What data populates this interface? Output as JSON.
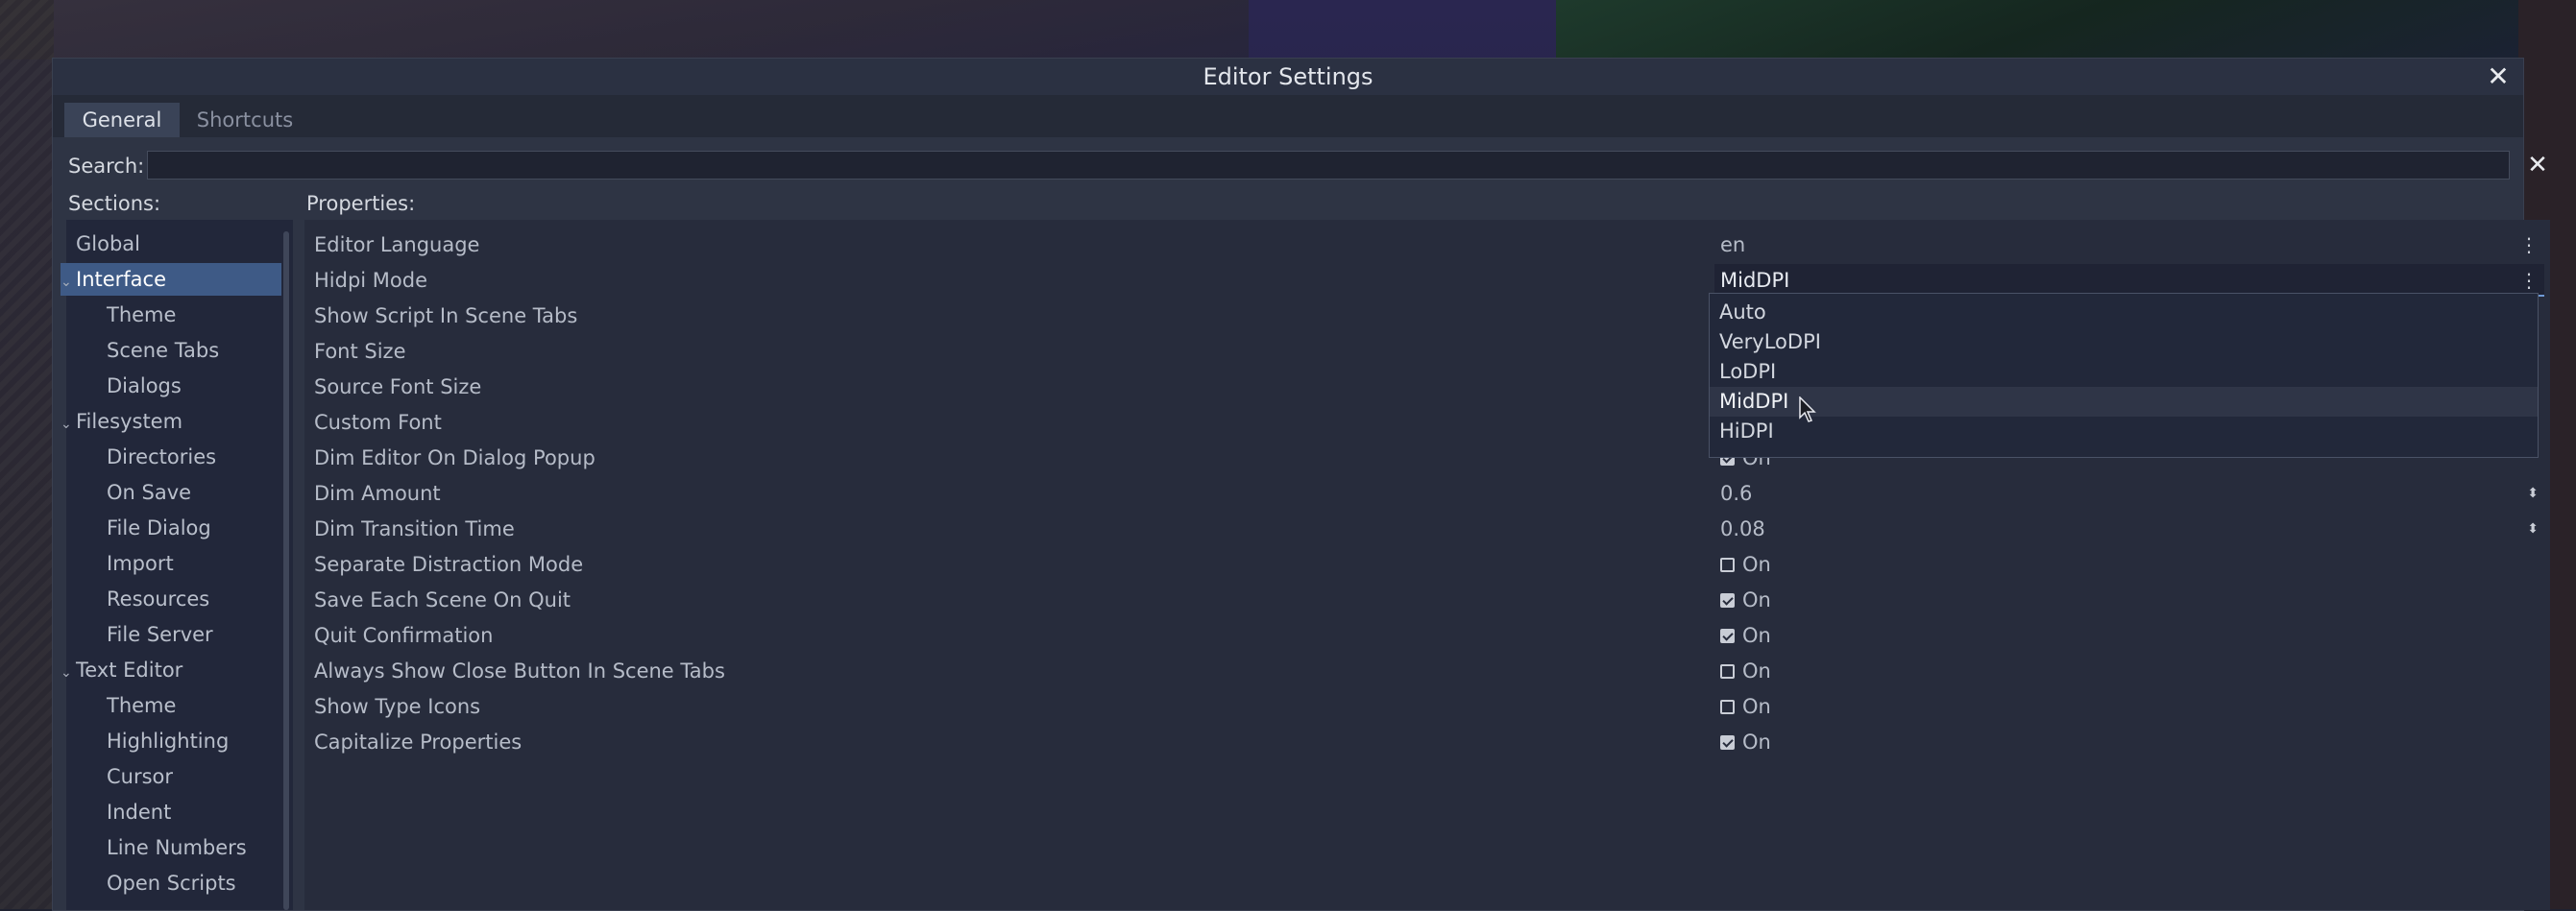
{
  "window": {
    "title": "Editor Settings"
  },
  "tabs": [
    {
      "label": "General",
      "active": true
    },
    {
      "label": "Shortcuts",
      "active": false
    }
  ],
  "search": {
    "label": "Search:",
    "value": ""
  },
  "sections_label": "Sections:",
  "properties_label": "Properties:",
  "sections": [
    {
      "label": "Global",
      "level": 0,
      "arrow": false
    },
    {
      "label": "Interface",
      "level": 0,
      "arrow": true,
      "selected": true
    },
    {
      "label": "Theme",
      "level": 1
    },
    {
      "label": "Scene Tabs",
      "level": 1
    },
    {
      "label": "Dialogs",
      "level": 1
    },
    {
      "label": "Filesystem",
      "level": 0,
      "arrow": true
    },
    {
      "label": "Directories",
      "level": 1
    },
    {
      "label": "On Save",
      "level": 1
    },
    {
      "label": "File Dialog",
      "level": 1
    },
    {
      "label": "Import",
      "level": 1
    },
    {
      "label": "Resources",
      "level": 1
    },
    {
      "label": "File Server",
      "level": 1
    },
    {
      "label": "Text Editor",
      "level": 0,
      "arrow": true
    },
    {
      "label": "Theme",
      "level": 1
    },
    {
      "label": "Highlighting",
      "level": 1
    },
    {
      "label": "Cursor",
      "level": 1
    },
    {
      "label": "Indent",
      "level": 1
    },
    {
      "label": "Line Numbers",
      "level": 1
    },
    {
      "label": "Open Scripts",
      "level": 1
    }
  ],
  "properties": [
    {
      "name": "Editor Language",
      "type": "enum",
      "value": "en",
      "icon": "menu-dots-icon"
    },
    {
      "name": "Hidpi Mode",
      "type": "enum",
      "value": "MidDPI",
      "active": true,
      "icon": "menu-dots-icon"
    },
    {
      "name": "Show Script In Scene Tabs",
      "type": "hidden",
      "value": ""
    },
    {
      "name": "Font Size",
      "type": "hidden",
      "value": "",
      "icon": "spin-icon"
    },
    {
      "name": "Source Font Size",
      "type": "hidden",
      "value": "",
      "icon": "spin-icon"
    },
    {
      "name": "Custom Font",
      "type": "hidden",
      "value": ""
    },
    {
      "name": "Dim Editor On Dialog Popup",
      "type": "check",
      "checked": true,
      "value": "On"
    },
    {
      "name": "Dim Amount",
      "type": "number",
      "value": "0.6",
      "icon": "spin-icon"
    },
    {
      "name": "Dim Transition Time",
      "type": "number",
      "value": "0.08",
      "icon": "spin-icon"
    },
    {
      "name": "Separate Distraction Mode",
      "type": "check",
      "checked": false,
      "value": "On"
    },
    {
      "name": "Save Each Scene On Quit",
      "type": "check",
      "checked": true,
      "value": "On"
    },
    {
      "name": "Quit Confirmation",
      "type": "check",
      "checked": true,
      "value": "On"
    },
    {
      "name": "Always Show Close Button In Scene Tabs",
      "type": "check",
      "checked": false,
      "value": "On"
    },
    {
      "name": "Show Type Icons",
      "type": "check",
      "checked": false,
      "value": "On"
    },
    {
      "name": "Capitalize Properties",
      "type": "check",
      "checked": true,
      "value": "On"
    }
  ],
  "dropdown": {
    "options": [
      "Auto",
      "VeryLoDPI",
      "LoDPI",
      "MidDPI",
      "HiDPI"
    ],
    "hovered": "MidDPI"
  },
  "colors": {
    "accent": "#3e5a86",
    "panel": "#272c3c",
    "title_bar": "#2b3142"
  }
}
